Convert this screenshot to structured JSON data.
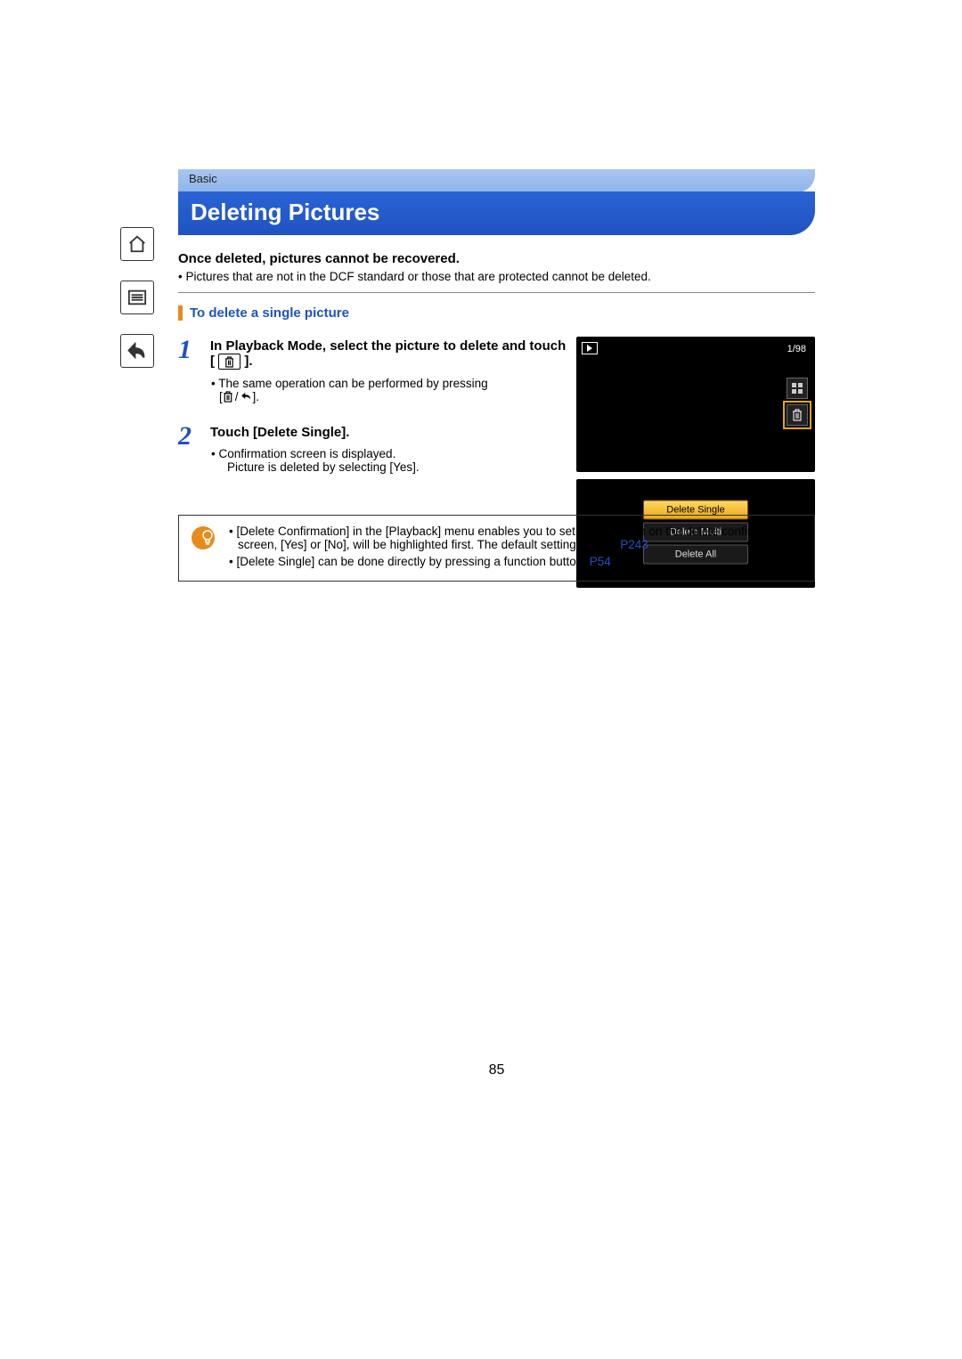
{
  "chapter": "Basic",
  "title": "Deleting Pictures",
  "warning": "Once deleted, pictures cannot be recovered.",
  "warning_note": "• Pictures that are not in the DCF standard or those that are protected cannot be deleted.",
  "sub_heading": "To delete a single picture",
  "step1_num": "1",
  "step1_title_a": "In Playback Mode, select the picture to delete and touch [",
  "step1_title_b": "].",
  "step1_sub_a": "• The same operation can be performed by pressing",
  "step1_sub_b": "[",
  "step1_sub_c": "].",
  "step2_num": "2",
  "step2_title": "Touch [Delete Single].",
  "step2_sub_a": "• Confirmation screen is displayed.",
  "step2_sub_b": "Picture is deleted by selecting [Yes].",
  "screen_counter": "1/98",
  "menu": {
    "item1": "Delete Single",
    "item2": "Delete Multi",
    "item3": "Delete All"
  },
  "tip1_a": "• [Delete Confirmation] in the [Playback] menu enables you to set which option on the delete confirmation screen, [Yes] or [No], will be highlighted first. The default setting is [No]. ",
  "tip1_link": "P243",
  "tip2_a": "• [Delete Single] can be done directly by pressing a function button. ",
  "tip2_link": "P54",
  "page_number": "85"
}
